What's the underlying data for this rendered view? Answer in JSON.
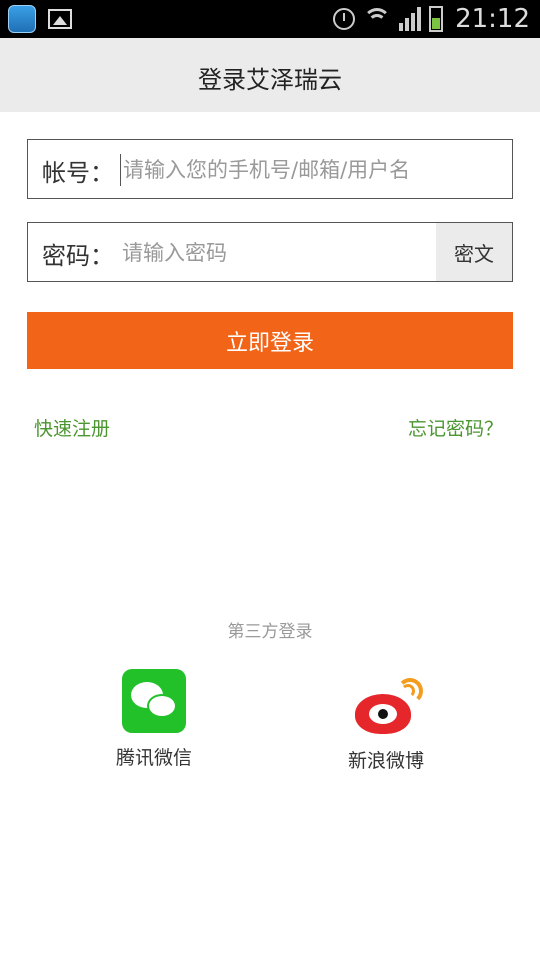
{
  "status_bar": {
    "time": "21:12",
    "battery_color": "#7bc242"
  },
  "header": {
    "title": "登录艾泽瑞云",
    "background": "#ebebeb"
  },
  "form": {
    "account_label": "帐号：",
    "account_placeholder": "请输入您的手机号/邮箱/用户名",
    "account_value": "",
    "password_label": "密码：",
    "password_placeholder": "请输入密码",
    "password_value": "",
    "password_toggle_label": "密文"
  },
  "login_button": {
    "label": "立即登录",
    "color": "#f26418"
  },
  "links": {
    "register": "快速注册",
    "forgot_password": "忘记密码？",
    "color": "#4b9630"
  },
  "third_party": {
    "label": "第三方登录",
    "providers": [
      {
        "name": "腾讯微信",
        "icon": "wechat-icon"
      },
      {
        "name": "新浪微博",
        "icon": "weibo-icon"
      }
    ]
  }
}
